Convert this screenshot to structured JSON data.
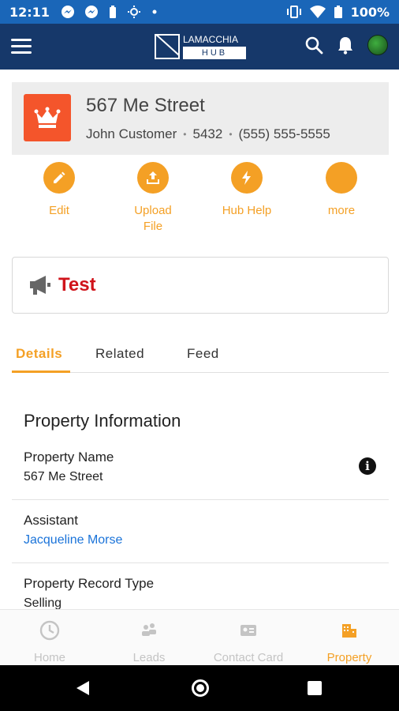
{
  "status_bar": {
    "time": "12:11",
    "battery": "100%",
    "icons": [
      "messenger-icon",
      "messenger-icon",
      "battery-saver-icon",
      "sun-icon",
      "dot-icon",
      "vibrate-icon",
      "wifi-icon",
      "battery-icon"
    ]
  },
  "app_bar": {
    "logo_line1": "LAMACCHIA",
    "logo_line2": "HUB",
    "icons": [
      "menu-icon",
      "search-icon",
      "bell-icon",
      "avatar"
    ]
  },
  "record": {
    "title": "567 Me Street",
    "customer": "John Customer",
    "code": "5432",
    "phone": "(555) 555-5555",
    "icon": "crown-icon"
  },
  "actions": [
    {
      "label": "Edit",
      "icon": "pencil-icon"
    },
    {
      "label": "Upload",
      "label2": "File",
      "icon": "upload-icon"
    },
    {
      "label": "Hub Help",
      "icon": "lightning-icon"
    },
    {
      "label": "more",
      "icon": "more-icon"
    }
  ],
  "announcement": {
    "text": "Test",
    "icon": "megaphone-icon"
  },
  "tabs": [
    {
      "label": "Details",
      "active": true
    },
    {
      "label": "Related",
      "active": false
    },
    {
      "label": "Feed",
      "active": false
    }
  ],
  "section": {
    "title": "Property Information",
    "fields": [
      {
        "label": "Property Name",
        "value": "567 Me Street"
      },
      {
        "label": "Assistant",
        "value": "Jacqueline Morse"
      },
      {
        "label": "Property Record Type",
        "value": "Selling"
      }
    ]
  },
  "bottom_nav": [
    {
      "label": "Home",
      "icon": "clock-icon"
    },
    {
      "label": "Leads",
      "icon": "leads-icon"
    },
    {
      "label": "Contact Card",
      "icon": "contact-card-icon"
    },
    {
      "label": "Property",
      "icon": "building-icon"
    }
  ],
  "colors": {
    "status_bar": "#1a66b8",
    "app_bar": "#16386a",
    "accent": "#f4a025",
    "record_icon": "#f4552b",
    "announcement_text": "#d0131a",
    "link": "#1a73d9"
  }
}
